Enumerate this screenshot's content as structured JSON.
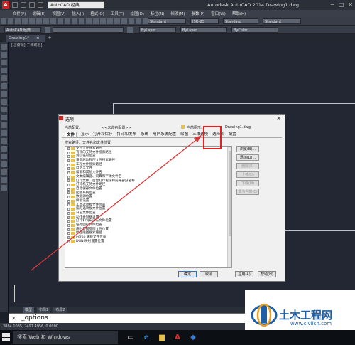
{
  "titlebar": {
    "workspace": "AutoCAD 经典",
    "app_title": "Autodesk AutoCAD 2014    Drawing1.dwg",
    "min": "─",
    "max": "□",
    "close": "✕"
  },
  "menu": [
    "文件(F)",
    "编辑(E)",
    "视图(V)",
    "插入(I)",
    "格式(O)",
    "工具(T)",
    "绘图(D)",
    "标注(N)",
    "修改(M)",
    "参数(P)",
    "窗口(W)",
    "帮助(H)"
  ],
  "toolbar": {
    "combo_style1": "Standard",
    "combo_dim": "ISO-25",
    "combo_style2": "Standard",
    "combo_style3": "Standard",
    "combo_ws2": "AutoCAD 经典",
    "combo_bylayer1": "ByLayer",
    "combo_bylayer2": "ByLayer",
    "combo_bycolor": "ByColor"
  },
  "tabs": {
    "doc": "Drawing1*",
    "doc_close": "×",
    "add": "+"
  },
  "viewport_label": "[-][俯视][二维线框]",
  "layouts": [
    "模型",
    "布局1",
    "布局2"
  ],
  "command": {
    "icon": "✕",
    "text": "_options"
  },
  "status": "3884.1085, 2497.4956, 0.0000",
  "taskbar": {
    "search": "搜索 Web 和 Windows"
  },
  "dialog": {
    "title": "选项",
    "close": "✕",
    "current_profile_label": "当前配置:",
    "current_profile_value": "<<未命名配置>>",
    "current_drawing_label": "当前图形:",
    "current_drawing_value": "Drawing1.dwg",
    "tabs": [
      "文件",
      "显示",
      "打开和保存",
      "打印和发布",
      "系统",
      "用户系统配置",
      "绘图",
      "三维建模",
      "选择集",
      "配置"
    ],
    "active_tab": 0,
    "search_label": "搜索路径、文件名和文件位置:",
    "tree": [
      "支持文件搜索路径",
      "有效的支持文件搜索路径",
      "受信任的位置",
      "设备驱动程序文件搜索路径",
      "工程文件搜索路径",
      "自定义文件",
      "帮助和其他文件名",
      "文本编辑器、词典和字体文件名",
      "打印文件、后台打印程序和前导部分名称",
      "打印机支持文件路径",
      "自动保存文件位置",
      "配色系统位置",
      "数据源位置",
      "样板设置",
      "工具选项板文件位置",
      "编写选项板文件位置",
      "日志文件位置",
      "动作录制器设置",
      "打印和发布日志文件位置",
      "临时图形文件位置",
      "临时外部参照文件位置",
      "纹理贴图搜索路径",
      "i-drop 关联文件位置",
      "DGN 映射设置位置"
    ],
    "buttons": {
      "browse": "浏览(B)...",
      "add": "添加(D)...",
      "delete": "删除(R)",
      "move_up": "上移(U)",
      "move_down": "下移(M)",
      "set_current": "置为当前(C)"
    },
    "footer": {
      "ok": "确定",
      "cancel": "取消",
      "apply": "应用(A)",
      "help": "帮助(H)"
    }
  },
  "watermark": {
    "title": "土木工程网",
    "url": "www.civilcn.com"
  },
  "colors": {
    "highlight": "#e02020",
    "arrow": "#d9383a",
    "watermark_blue": "#1e5fa8"
  }
}
